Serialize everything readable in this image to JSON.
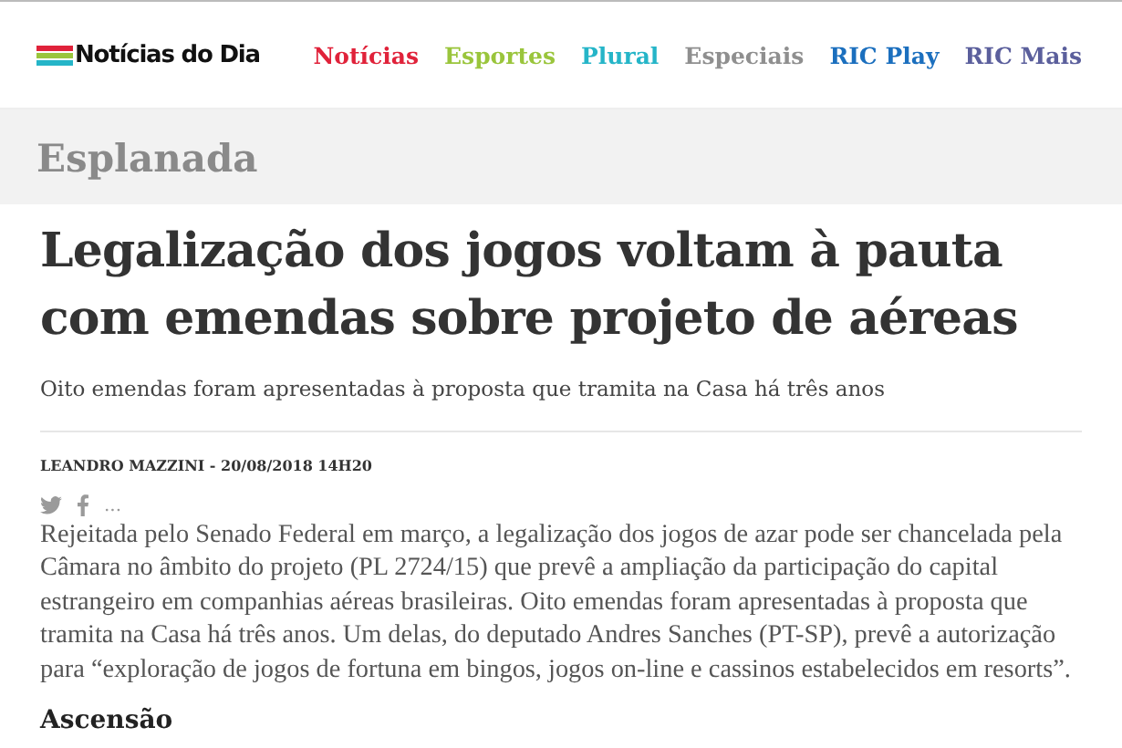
{
  "header": {
    "logo": "Notícias do Dia",
    "nav": [
      {
        "label": "Notícias",
        "color": "#e0223a"
      },
      {
        "label": "Esportes",
        "color": "#9ac53c"
      },
      {
        "label": "Plural",
        "color": "#25b5c8"
      },
      {
        "label": "Especiais",
        "color": "#8f8f8f"
      },
      {
        "label": "RIC Play",
        "color": "#1b6fbe"
      },
      {
        "label": "RIC Mais",
        "color": "#5b5f9c"
      }
    ]
  },
  "section": "Esplanada",
  "article": {
    "title": "Legalização dos jogos voltam à pauta com emendas sobre projeto de aéreas",
    "subtitle": "Oito emendas foram apresentadas à proposta que tramita na Casa há três anos",
    "byline": "LEANDRO MAZZINI - 20/08/2018 14H20",
    "more": "...",
    "body": "Rejeitada pelo Senado Federal em março, a legalização dos jogos de azar pode ser chancelada pela Câmara no âmbito do projeto (PL 2724/15) que prevê a ampliação da participação do capital estrangeiro em companhias aéreas brasileiras. Oito emendas foram apresentadas à proposta que tramita na Casa há três anos. Um delas, do deputado Andres Sanches (PT-SP), prevê a autorização para “exploração de jogos de fortuna em bingos, jogos on-line e cassinos estabelecidos em resorts”.",
    "next_heading": "Ascensão"
  }
}
